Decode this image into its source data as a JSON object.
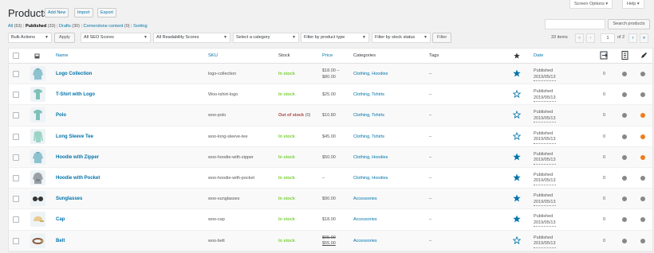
{
  "header": {
    "title": "Products",
    "add_new": "Add New",
    "import": "Import",
    "export": "Export",
    "screen_options": "Screen Options ▾",
    "help": "Help ▾"
  },
  "views": {
    "all": "All",
    "all_count": "(63)",
    "published": "Published",
    "published_count": "(33)",
    "drafts": "Drafts",
    "drafts_count": "(30)",
    "cornerstone": "Cornerstone content",
    "cornerstone_count": "(0)",
    "sorting": "Sorting"
  },
  "search": {
    "button": "Search products",
    "placeholder": ""
  },
  "filters": {
    "bulk_actions": "Bulk Actions",
    "apply": "Apply",
    "seo_scores": "All SEO Scores",
    "readability": "All Readability Scores",
    "category": "Select a category",
    "product_type": "Filter by product type",
    "stock_status": "Filter by stock status",
    "filter": "Filter"
  },
  "pagination": {
    "items": "33 items",
    "first": "«",
    "prev": "‹",
    "current": "1",
    "of": "of 2",
    "next": "›",
    "last": "»"
  },
  "columns": {
    "name": "Name",
    "sku": "SKU",
    "stock": "Stock",
    "price": "Price",
    "categories": "Categories",
    "tags": "Tags",
    "date": "Date"
  },
  "icons": {
    "thumbnail": "image-icon",
    "featured": "star-icon",
    "seo": "seo-links-icon",
    "readability": "readability-icon",
    "edit": "pen-icon"
  },
  "colors": {
    "link": "#0073aa",
    "in_stock": "#7ad03a",
    "out_of_stock": "#aa4444",
    "featured_star": "#0073aa",
    "dot_gray": "#888888",
    "dot_orange": "#ee7c1b"
  },
  "products": [
    {
      "name": "Logo Collection",
      "sku": "logo-collection",
      "stock": "In stock",
      "stock_count": "",
      "price_line1": "$18.00 –",
      "price_line2": "$80.00",
      "price_old": "",
      "price_new": "",
      "categories": "Clothing, Hoodies",
      "tags": "–",
      "featured": true,
      "status": "Published",
      "date": "2019/05/13",
      "links": "0",
      "seo": "gray",
      "readability": "gray",
      "thumb": "hoodie"
    },
    {
      "name": "T-Shirt with Logo",
      "sku": "Woo-tshirt-logo",
      "stock": "In stock",
      "stock_count": "",
      "price_line1": "$25.00",
      "price_line2": "",
      "price_old": "",
      "price_new": "",
      "categories": "Clothing, Tshirts",
      "tags": "–",
      "featured": false,
      "status": "Published",
      "date": "2019/05/13",
      "links": "0",
      "seo": "gray",
      "readability": "gray",
      "thumb": "tshirt"
    },
    {
      "name": "Polo",
      "sku": "woo-polo",
      "stock": "Out of stock",
      "stock_count": "(0)",
      "price_line1": "$10.80",
      "price_line2": "",
      "price_old": "",
      "price_new": "",
      "categories": "Clothing, Tshirts",
      "tags": "–",
      "featured": false,
      "status": "Published",
      "date": "2019/05/13",
      "links": "0",
      "seo": "gray",
      "readability": "orange",
      "thumb": "tshirt"
    },
    {
      "name": "Long Sleeve Tee",
      "sku": "woo-long-sleeve-tee",
      "stock": "In stock",
      "stock_count": "",
      "price_line1": "$45.00",
      "price_line2": "",
      "price_old": "",
      "price_new": "",
      "categories": "Clothing, Tshirts",
      "tags": "–",
      "featured": false,
      "status": "Published",
      "date": "2019/05/13",
      "links": "0",
      "seo": "gray",
      "readability": "orange",
      "thumb": "longsleeve"
    },
    {
      "name": "Hoodie with Zipper",
      "sku": "woo-hoodie-with-zipper",
      "stock": "In stock",
      "stock_count": "",
      "price_line1": "$50.00",
      "price_line2": "",
      "price_old": "",
      "price_new": "",
      "categories": "Clothing, Hoodies",
      "tags": "–",
      "featured": true,
      "status": "Published",
      "date": "2019/05/13",
      "links": "0",
      "seo": "gray",
      "readability": "orange",
      "thumb": "hoodie"
    },
    {
      "name": "Hoodie with Pocket",
      "sku": "woo-hoodie-with-pocket",
      "stock": "In stock",
      "stock_count": "",
      "price_line1": "–",
      "price_line2": "",
      "price_old": "",
      "price_new": "",
      "categories": "Clothing, Hoodies",
      "tags": "–",
      "featured": true,
      "status": "Published",
      "date": "2019/05/13",
      "links": "0",
      "seo": "gray",
      "readability": "gray",
      "thumb": "hoodie-gray"
    },
    {
      "name": "Sunglasses",
      "sku": "woo-sunglasses",
      "stock": "In stock",
      "stock_count": "",
      "price_line1": "$90.00",
      "price_line2": "",
      "price_old": "",
      "price_new": "",
      "categories": "Accessories",
      "tags": "–",
      "featured": true,
      "status": "Published",
      "date": "2019/05/13",
      "links": "0",
      "seo": "gray",
      "readability": "gray",
      "thumb": "sunglasses"
    },
    {
      "name": "Cap",
      "sku": "woo-cap",
      "stock": "In stock",
      "stock_count": "",
      "price_line1": "$18.00",
      "price_line2": "",
      "price_old": "",
      "price_new": "",
      "categories": "Accessories",
      "tags": "–",
      "featured": true,
      "status": "Published",
      "date": "2019/05/13",
      "links": "0",
      "seo": "gray",
      "readability": "gray",
      "thumb": "cap"
    },
    {
      "name": "Belt",
      "sku": "woo-belt",
      "stock": "In stock",
      "stock_count": "",
      "price_line1": "",
      "price_line2": "",
      "price_old": "$65.00",
      "price_new": "$55.00",
      "categories": "Accessories",
      "tags": "–",
      "featured": false,
      "status": "Published",
      "date": "2019/05/13",
      "links": "0",
      "seo": "gray",
      "readability": "gray",
      "thumb": "belt"
    }
  ]
}
